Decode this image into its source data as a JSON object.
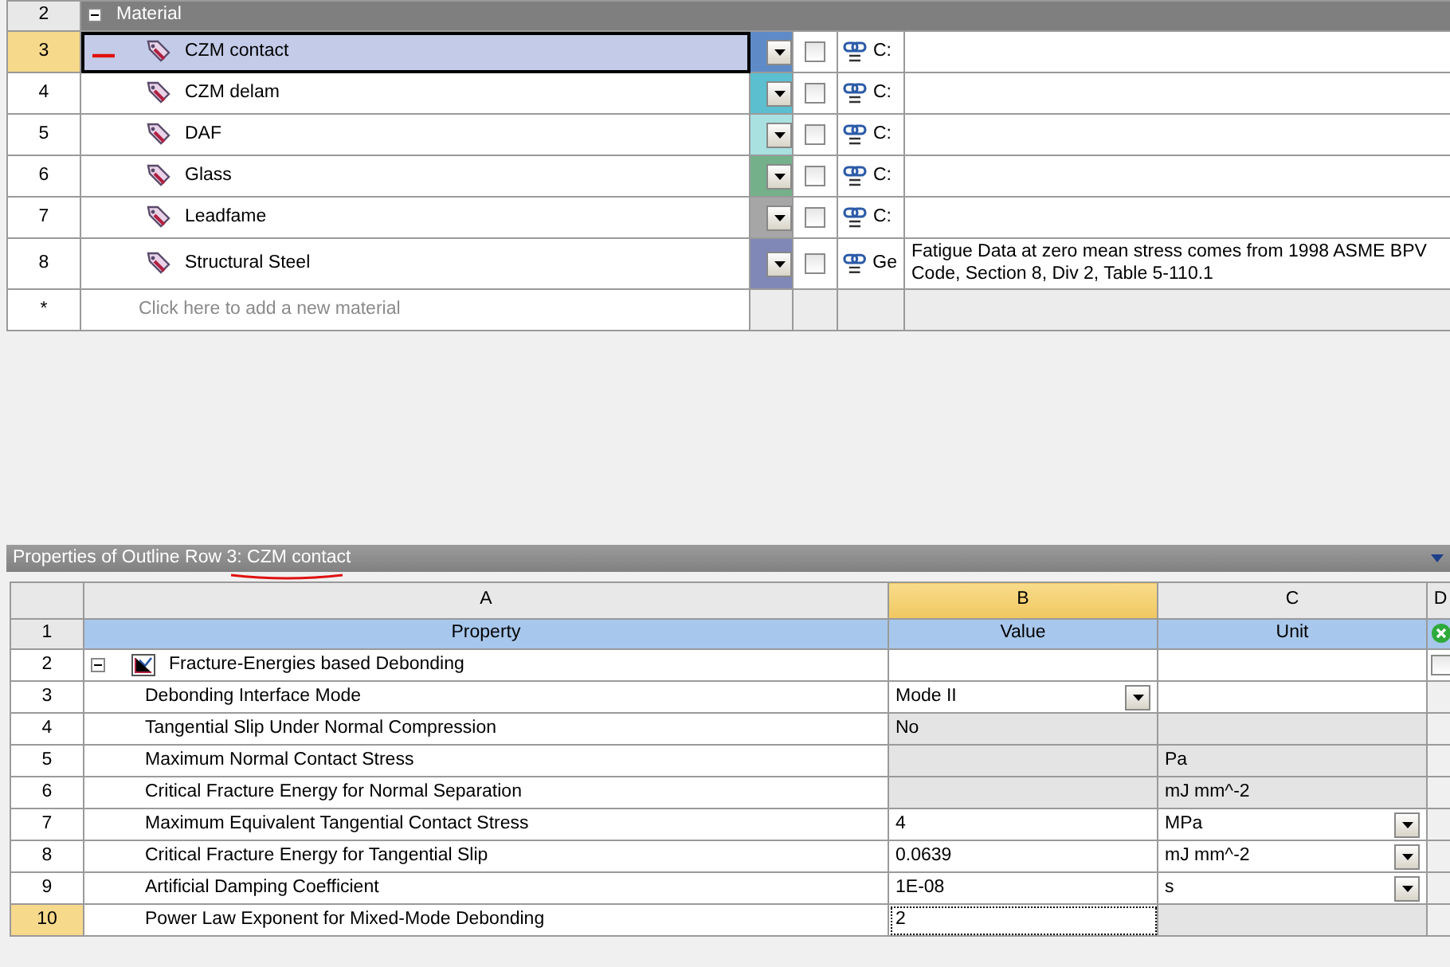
{
  "outline": {
    "group": {
      "row": "2",
      "label": "Material",
      "expanded": true
    },
    "rows": [
      {
        "row": "3",
        "name": "CZM contact",
        "color": "#5e8bc8",
        "checked": false,
        "source": "C:",
        "description": "",
        "selected": true
      },
      {
        "row": "4",
        "name": "CZM delam",
        "color": "#5bbfcf",
        "checked": false,
        "source": "C:",
        "description": "",
        "selected": false
      },
      {
        "row": "5",
        "name": "DAF",
        "color": "#a9e0e0",
        "checked": false,
        "source": "C:",
        "description": "",
        "selected": false
      },
      {
        "row": "6",
        "name": "Glass",
        "color": "#74b08a",
        "checked": false,
        "source": "C:",
        "description": "",
        "selected": false
      },
      {
        "row": "7",
        "name": "Leadfame",
        "color": "#a6a6a6",
        "checked": false,
        "source": "C:",
        "description": "",
        "selected": false
      },
      {
        "row": "8",
        "name": "Structural Steel",
        "color": "#8088b8",
        "checked": false,
        "source": "Ge",
        "description": "Fatigue Data at zero mean stress comes from 1998 ASME BPV Code, Section 8, Div 2, Table 5-110.1",
        "selected": false
      }
    ],
    "new_row": {
      "row": "*",
      "placeholder": "Click here to add a new material"
    }
  },
  "properties": {
    "title": "Properties of Outline Row 3: CZM contact",
    "columns": [
      {
        "label": "A",
        "selected": false
      },
      {
        "label": "B",
        "selected": true
      },
      {
        "label": "C",
        "selected": false
      },
      {
        "label": "D",
        "selected": false
      }
    ],
    "header": {
      "row": "1",
      "cells": [
        "Property",
        "Value",
        "Unit"
      ]
    },
    "group": {
      "row": "2",
      "label": "Fracture-Energies based Debonding",
      "expanded": true,
      "checked": false
    },
    "rows": [
      {
        "row": "3",
        "property": "Debonding Interface Mode",
        "value": "Mode II",
        "unit": "",
        "value_editable": true,
        "unit_editable": true,
        "value_dropdown": true,
        "unit_dropdown": false,
        "selected": false
      },
      {
        "row": "4",
        "property": "Tangential Slip Under Normal Compression",
        "value": "No",
        "unit": "",
        "value_editable": false,
        "unit_editable": false,
        "value_dropdown": false,
        "unit_dropdown": false,
        "selected": false
      },
      {
        "row": "5",
        "property": "Maximum Normal Contact Stress",
        "value": "",
        "unit": "Pa",
        "value_editable": false,
        "unit_editable": false,
        "value_dropdown": false,
        "unit_dropdown": false,
        "selected": false
      },
      {
        "row": "6",
        "property": "Critical Fracture Energy for Normal Separation",
        "value": "",
        "unit": "mJ mm^-2",
        "value_editable": false,
        "unit_editable": false,
        "value_dropdown": false,
        "unit_dropdown": false,
        "selected": false
      },
      {
        "row": "7",
        "property": "Maximum Equivalent Tangential Contact Stress",
        "value": "4",
        "unit": "MPa",
        "value_editable": true,
        "unit_editable": true,
        "value_dropdown": false,
        "unit_dropdown": true,
        "selected": false
      },
      {
        "row": "8",
        "property": "Critical Fracture Energy for Tangential Slip",
        "value": "0.0639",
        "unit": "mJ mm^-2",
        "value_editable": true,
        "unit_editable": true,
        "value_dropdown": false,
        "unit_dropdown": true,
        "selected": false
      },
      {
        "row": "9",
        "property": "Artificial Damping Coefficient",
        "value": "1E-08",
        "unit": "s",
        "value_editable": true,
        "unit_editable": true,
        "value_dropdown": false,
        "unit_dropdown": true,
        "selected": false
      },
      {
        "row": "10",
        "property": "Power Law Exponent for Mixed-Mode Debonding",
        "value": "2",
        "unit": "",
        "value_editable": true,
        "unit_editable": false,
        "value_dropdown": false,
        "unit_dropdown": false,
        "selected": true
      }
    ]
  }
}
